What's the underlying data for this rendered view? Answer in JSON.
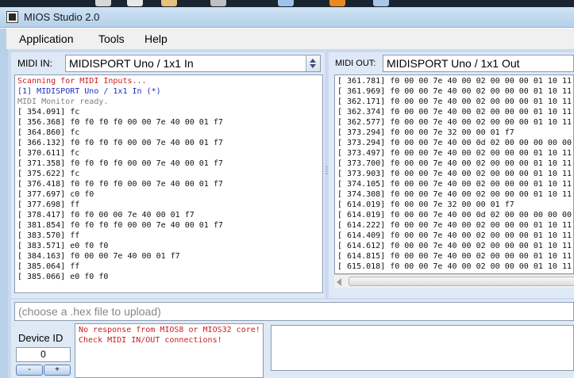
{
  "window": {
    "title": "MIOS Studio 2.0"
  },
  "menu": {
    "items": [
      "Application",
      "Tools",
      "Help"
    ]
  },
  "midi_in": {
    "label": "MIDI IN:",
    "selected": "MIDISPORT Uno / 1x1 In",
    "log": [
      {
        "text": "Scanning for MIDI Inputs...",
        "color": "red"
      },
      {
        "text": "[1] MIDISPORT Uno / 1x1 In (*)",
        "color": "blue"
      },
      {
        "text": "MIDI Monitor ready.",
        "color": "grey"
      },
      {
        "text": "[ 354.091] fc",
        "color": "black"
      },
      {
        "text": "[ 356.368] f0 f0 f0 f0 00 00 7e 40 00 01 f7",
        "color": "black"
      },
      {
        "text": "[ 364.860] fc",
        "color": "black"
      },
      {
        "text": "[ 366.132] f0 f0 f0 f0 00 00 7e 40 00 01 f7",
        "color": "black"
      },
      {
        "text": "[ 370.611] fc",
        "color": "black"
      },
      {
        "text": "[ 371.358] f0 f0 f0 f0 00 00 7e 40 00 01 f7",
        "color": "black"
      },
      {
        "text": "[ 375.622] fc",
        "color": "black"
      },
      {
        "text": "[ 376.418] f0 f0 f0 f0 00 00 7e 40 00 01 f7",
        "color": "black"
      },
      {
        "text": "[ 377.697] c0 f0",
        "color": "black"
      },
      {
        "text": "[ 377.698] ff",
        "color": "black"
      },
      {
        "text": "[ 378.417] f0 f0 00 00 7e 40 00 01 f7",
        "color": "black"
      },
      {
        "text": "[ 381.854] f0 f0 f0 f0 00 00 7e 40 00 01 f7",
        "color": "black"
      },
      {
        "text": "[ 383.570] ff",
        "color": "black"
      },
      {
        "text": "[ 383.571] e0 f0 f0",
        "color": "black"
      },
      {
        "text": "[ 384.163] f0 00 00 7e 40 00 01 f7",
        "color": "black"
      },
      {
        "text": "[ 385.064] ff",
        "color": "black"
      },
      {
        "text": "[ 385.066] e0 f0 f0",
        "color": "black"
      }
    ]
  },
  "midi_out": {
    "label": "MIDI OUT:",
    "selected": "MIDISPORT Uno / 1x1 Out",
    "log": [
      "[ 361.781] f0 00 00 7e 40 00 02 00 00 00 01 10 11",
      "[ 361.969] f0 00 00 7e 40 00 02 00 00 00 01 10 11",
      "[ 362.171] f0 00 00 7e 40 00 02 00 00 00 01 10 11",
      "[ 362.374] f0 00 00 7e 40 00 02 00 00 00 01 10 11",
      "[ 362.577] f0 00 00 7e 40 00 02 00 00 00 01 10 11",
      "[ 373.294] f0 00 00 7e 32 00 00 01 f7",
      "[ 373.294] f0 00 00 7e 40 00 0d 02 00 00 00 00 00",
      "[ 373.497] f0 00 00 7e 40 00 02 00 00 00 01 10 11",
      "[ 373.700] f0 00 00 7e 40 00 02 00 00 00 01 10 11",
      "[ 373.903] f0 00 00 7e 40 00 02 00 00 00 01 10 11",
      "[ 374.105] f0 00 00 7e 40 00 02 00 00 00 01 10 11",
      "[ 374.308] f0 00 00 7e 40 00 02 00 00 00 01 10 11",
      "[ 614.019] f0 00 00 7e 32 00 00 01 f7",
      "[ 614.019] f0 00 00 7e 40 00 0d 02 00 00 00 00 00",
      "[ 614.222] f0 00 00 7e 40 00 02 00 00 00 01 10 11",
      "[ 614.409] f0 00 00 7e 40 00 02 00 00 00 01 10 11",
      "[ 614.612] f0 00 00 7e 40 00 02 00 00 00 01 10 11",
      "[ 614.815] f0 00 00 7e 40 00 02 00 00 00 01 10 11",
      "[ 615.018] f0 00 00 7e 40 00 02 00 00 00 01 10 11"
    ]
  },
  "upload": {
    "placeholder": "(choose a .hex file to upload)"
  },
  "device": {
    "label": "Device ID",
    "value": "0",
    "minus": "-",
    "plus": "+"
  },
  "status": {
    "lines": [
      "No response from MIOS8 or MIOS32 core!",
      "Check MIDI IN/OUT connections!"
    ]
  },
  "colors": {
    "log_red": "#cc2020",
    "log_blue": "#1d2ec0",
    "log_grey": "#808080",
    "panel_bg": "#dfe9f6"
  }
}
